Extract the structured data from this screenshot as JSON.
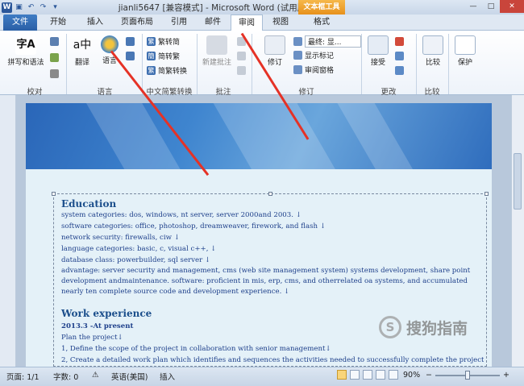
{
  "window": {
    "title": "jianli5647 [兼容模式] - Microsoft Word (试用版)",
    "context_group": "文本框工具",
    "min": "—",
    "max": "□",
    "close": "✕"
  },
  "tabs": [
    {
      "label": "文件"
    },
    {
      "label": "开始"
    },
    {
      "label": "插入"
    },
    {
      "label": "页面布局"
    },
    {
      "label": "引用"
    },
    {
      "label": "邮件"
    },
    {
      "label": "审阅"
    },
    {
      "label": "视图"
    },
    {
      "label": "格式"
    }
  ],
  "ribbon": {
    "proofing": {
      "label": "校对",
      "spelling": "拼写和语法"
    },
    "language": {
      "label": "语言",
      "translate": "翻译",
      "language": "语言"
    },
    "chinese": {
      "label": "中文简繁转换",
      "to_trad": "繁转简",
      "to_simp": "简转繁",
      "convert": "简繁转换"
    },
    "comments": {
      "label": "批注",
      "new": "新建批注"
    },
    "tracking": {
      "label": "修订",
      "track": "修订",
      "final_show": "最终: 显...",
      "show_markup": "显示标记",
      "review_pane": "审阅窗格"
    },
    "changes": {
      "label": "更改",
      "accept": "接受"
    },
    "compare": {
      "label": "比较",
      "compare": "比较"
    },
    "protect": {
      "label": "",
      "protect": "保护"
    }
  },
  "document": {
    "education_title": "Education",
    "edu_lines": [
      "system categories: dos, windows, nt server, server 2000and 2003. ↓",
      "software categories: office, photoshop, dreamweaver, firework, and flash ↓",
      "network security: firewalls, ciw ↓",
      "language categories: basic, c, visual c++, ↓",
      "database class: powerbuilder, sql server ↓"
    ],
    "advantage": "advantage: server security and management, cms (web site management system) systems development, share point development andmaintenance. software: proficient in mis, erp, cms, and otherrelated oa systems, and accumulated nearly ten complete source code and development experience. ↓",
    "work_title": "Work experience",
    "work_date": "2013.3 -At present",
    "work_lines": [
      "Plan the project↓",
      "1, Define the scope of the project in collaboration with senior management↓",
      "2, Create a detailed work plan which identifies and sequences the activities needed to successfully complete the project ↓"
    ]
  },
  "status": {
    "page": "页面: 1/1",
    "words": "字数: 0",
    "language": "英语(美国)",
    "mode": "插入",
    "zoom": "90%",
    "zoom_minus": "−",
    "zoom_plus": "+"
  },
  "watermark": {
    "text": "搜狗指南",
    "logo": "S"
  }
}
